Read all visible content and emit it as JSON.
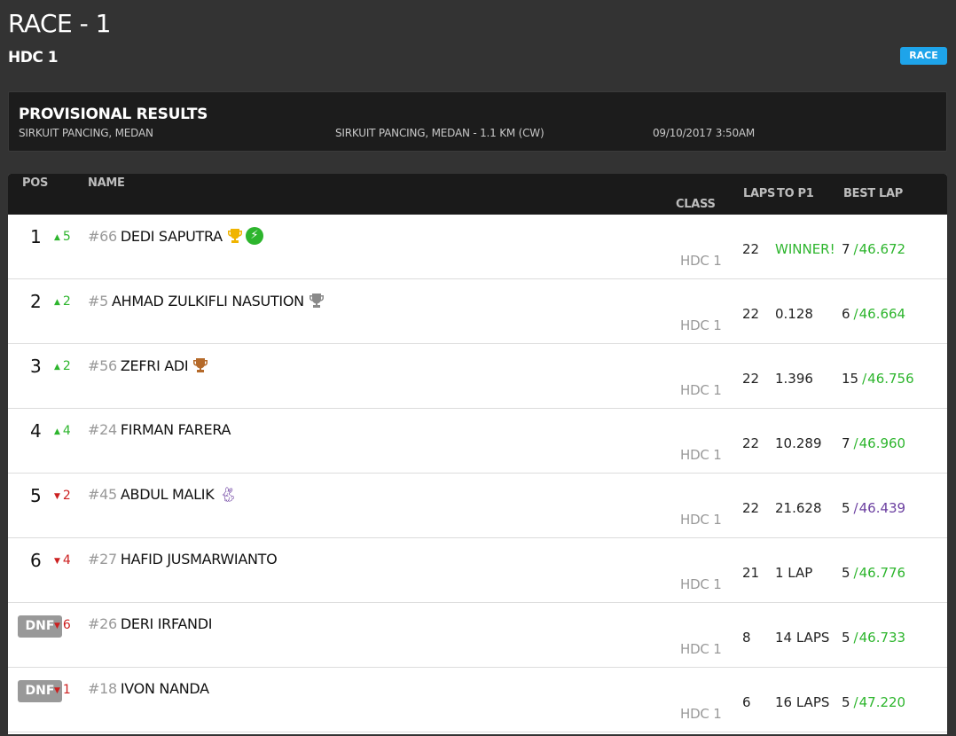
{
  "header": {
    "title": "RACE - 1",
    "subtitle": "HDC 1",
    "badge": "RACE"
  },
  "info": {
    "title": "PROVISIONAL RESULTS",
    "track": "SIRKUIT PANCING, MEDAN",
    "track_detail": "SIRKUIT PANCING, MEDAN - 1.1 KM (CW)",
    "datetime": "09/10/2017 3:50AM"
  },
  "table": {
    "headers": {
      "pos": "POS",
      "name": "NAME",
      "class": "CLASS",
      "laps": "LAPS",
      "to_p1": "TO P1",
      "best_lap": "BEST LAP"
    },
    "rows": [
      {
        "pos": "1",
        "change_dir": "up",
        "change": "5",
        "number": "#66",
        "name": "DEDI SAPUTRA",
        "class": "HDC 1",
        "laps": "22",
        "gap": "WINNER!",
        "best_lap_no": "7",
        "best_time": "46.672",
        "icons": [
          "gold-trophy",
          "fastest-lap-bolt"
        ]
      },
      {
        "pos": "2",
        "change_dir": "up",
        "change": "2",
        "number": "#5",
        "name": "AHMAD ZULKIFLI NASUTION",
        "class": "HDC 1",
        "laps": "22",
        "gap": "0.128",
        "best_lap_no": "6",
        "best_time": "46.664",
        "icons": [
          "silver-trophy"
        ]
      },
      {
        "pos": "3",
        "change_dir": "up",
        "change": "2",
        "number": "#56",
        "name": "ZEFRI ADI",
        "class": "HDC 1",
        "laps": "22",
        "gap": "1.396",
        "best_lap_no": "15",
        "best_time": "46.756",
        "icons": [
          "bronze-trophy"
        ]
      },
      {
        "pos": "4",
        "change_dir": "up",
        "change": "4",
        "number": "#24",
        "name": "FIRMAN FARERA",
        "class": "HDC 1",
        "laps": "22",
        "gap": "10.289",
        "best_lap_no": "7",
        "best_time": "46.960",
        "icons": []
      },
      {
        "pos": "5",
        "change_dir": "down",
        "change": "2",
        "number": "#45",
        "name": "ABDUL MALIK",
        "class": "HDC 1",
        "laps": "22",
        "gap": "21.628",
        "best_lap_no": "5",
        "best_time": "46.439",
        "icons": [
          "rabbit"
        ]
      },
      {
        "pos": "6",
        "change_dir": "down",
        "change": "4",
        "number": "#27",
        "name": "HAFID JUSMARWIANTO",
        "class": "HDC 1",
        "laps": "21",
        "gap": "1 LAP",
        "best_lap_no": "5",
        "best_time": "46.776",
        "icons": []
      },
      {
        "pos": "DNF",
        "change_dir": "down",
        "change": "6",
        "number": "#26",
        "name": "DERI IRFANDI",
        "class": "HDC 1",
        "laps": "8",
        "gap": "14 LAPS",
        "best_lap_no": "5",
        "best_time": "46.733",
        "icons": []
      },
      {
        "pos": "DNF",
        "change_dir": "down",
        "change": "1",
        "number": "#18",
        "name": "IVON NANDA",
        "class": "HDC 1",
        "laps": "6",
        "gap": "16 LAPS",
        "best_lap_no": "5",
        "best_time": "47.220",
        "icons": []
      }
    ]
  },
  "colors": {
    "background": "#333333",
    "info_box": "#1c1c1c",
    "badge": "#1ea4ea",
    "positive": "#2db52d",
    "negative": "#cc1f1f",
    "overall_fastest": "#6b3fa0",
    "gold": "#f0b400",
    "silver": "#8a8a8a",
    "bronze": "#b56a2a"
  }
}
